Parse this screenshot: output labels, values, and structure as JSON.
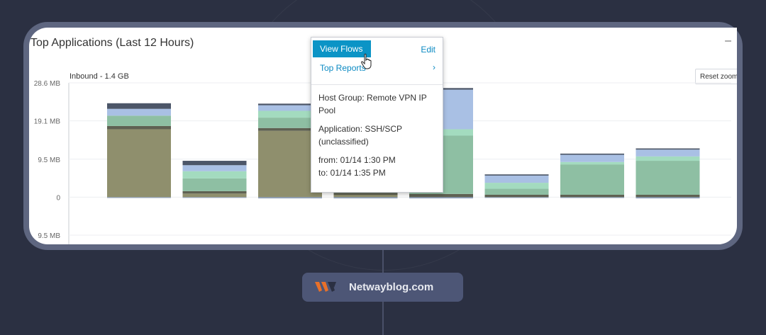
{
  "widget": {
    "title": "Top Applications (Last 12 Hours)",
    "minimize_label": "–",
    "reset_zoom_label": "Reset zoom"
  },
  "chart_data": {
    "type": "bar",
    "title": "",
    "series_label": "Inbound - 1.4 GB",
    "y_ticks": [
      "28.6 MB",
      "19.1 MB",
      "9.5 MB",
      "0",
      "9.5 MB"
    ],
    "y_values": [
      28.6,
      19.1,
      9.5,
      0,
      -9.5
    ],
    "ylim": [
      -9.5,
      28.6
    ],
    "bars": [
      {
        "segments": [
          {
            "v": 17.0,
            "c": "#8f8f6d"
          },
          {
            "v": 0.8,
            "c": "#5f6152"
          },
          {
            "v": 2.6,
            "c": "#8ebfa3"
          },
          {
            "v": 1.7,
            "c": "#a9c0e4"
          },
          {
            "v": 1.4,
            "c": "#4c5668"
          }
        ]
      },
      {
        "segments": [
          {
            "v": 0.9,
            "c": "#8f8f6d"
          },
          {
            "v": 0.6,
            "c": "#5f6152"
          },
          {
            "v": 3.2,
            "c": "#8ebfa3"
          },
          {
            "v": 1.8,
            "c": "#a3dbbf"
          },
          {
            "v": 1.5,
            "c": "#a9c0e4"
          },
          {
            "v": 1.1,
            "c": "#4c5668"
          }
        ]
      },
      {
        "segments": [
          {
            "v": 16.6,
            "c": "#8f8f6d"
          },
          {
            "v": 0.7,
            "c": "#5f6152"
          },
          {
            "v": 2.6,
            "c": "#8ebfa3"
          },
          {
            "v": 1.7,
            "c": "#a3dbbf"
          },
          {
            "v": 1.4,
            "c": "#a9c0e4"
          },
          {
            "v": 0.4,
            "c": "#4c5668"
          }
        ]
      },
      {
        "segments": [
          {
            "v": 0.6,
            "c": "#8f8f6d"
          },
          {
            "v": 0.5,
            "c": "#5f6152"
          },
          {
            "v": 2.6,
            "c": "#8ebfa3"
          }
        ]
      },
      {
        "segments": [
          {
            "v": 0.8,
            "c": "#5f6152"
          },
          {
            "v": 14.6,
            "c": "#8ebfa3"
          },
          {
            "v": 1.6,
            "c": "#a3dbbf"
          },
          {
            "v": 9.9,
            "c": "#a9c0e4"
          },
          {
            "v": 0.4,
            "c": "#4c5668"
          }
        ]
      },
      {
        "segments": [
          {
            "v": 0.6,
            "c": "#5f6152"
          },
          {
            "v": 1.5,
            "c": "#8ebfa3"
          },
          {
            "v": 1.5,
            "c": "#a3dbbf"
          },
          {
            "v": 1.8,
            "c": "#a9c0e4"
          },
          {
            "v": 0.3,
            "c": "#4c5668"
          }
        ]
      },
      {
        "segments": [
          {
            "v": 0.6,
            "c": "#5f6152"
          },
          {
            "v": 7.6,
            "c": "#8ebfa3"
          },
          {
            "v": 0.6,
            "c": "#a3dbbf"
          },
          {
            "v": 1.8,
            "c": "#a9c0e4"
          },
          {
            "v": 0.3,
            "c": "#4c5668"
          }
        ]
      },
      {
        "segments": [
          {
            "v": 0.6,
            "c": "#5f6152"
          },
          {
            "v": 8.5,
            "c": "#8ebfa3"
          },
          {
            "v": 1.1,
            "c": "#a3dbbf"
          },
          {
            "v": 1.7,
            "c": "#a9c0e4"
          },
          {
            "v": 0.3,
            "c": "#4c5668"
          }
        ]
      }
    ],
    "negative_stubs": [
      0.2,
      0.1,
      0.3,
      0.3,
      0.3,
      0.1,
      0.2,
      0.3
    ]
  },
  "popup": {
    "view_flows": "View Flows",
    "edit": "Edit",
    "top_reports": "Top Reports",
    "chevron": "›",
    "host_group_line1": "Host Group: Remote VPN IP",
    "host_group_line2": "Pool",
    "application_line1": "Application: SSH/SCP",
    "application_line2": "(unclassified)",
    "from": "from: 01/14 1:30 PM",
    "to": "to: 01/14 1:35 PM",
    "cursor_icon": "hand-pointer-icon"
  },
  "watermark": {
    "site": "Netwayblog.com",
    "logo_colors": [
      "#e8702a",
      "#2b3042"
    ]
  }
}
